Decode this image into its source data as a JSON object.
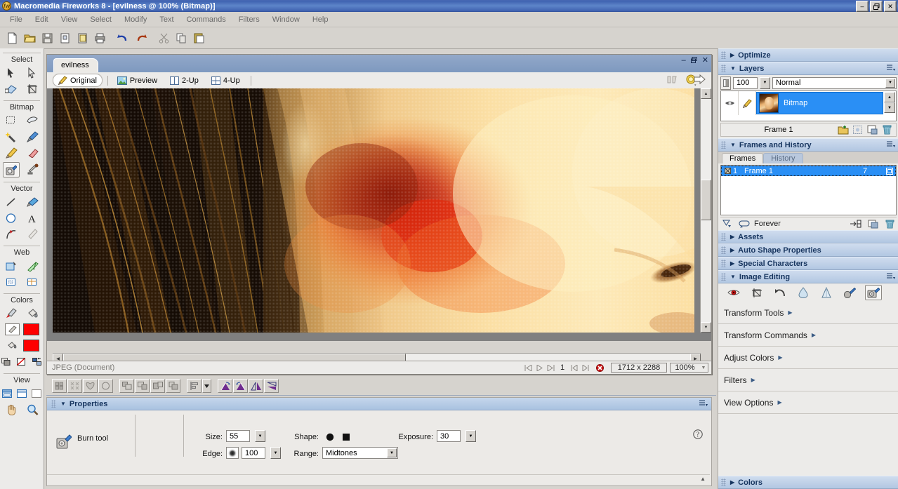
{
  "window": {
    "title": "Macromedia Fireworks 8 - [evilness @ 100% (Bitmap)]",
    "logo_text": "fw",
    "minimize": "–",
    "restore": "❐",
    "close": "✕"
  },
  "menubar": {
    "items": [
      "File",
      "Edit",
      "View",
      "Select",
      "Modify",
      "Text",
      "Commands",
      "Filters",
      "Window",
      "Help"
    ]
  },
  "main_toolbar": {
    "buttons": [
      {
        "name": "new-document-icon",
        "tip": "New"
      },
      {
        "name": "open-folder-icon",
        "tip": "Open"
      },
      {
        "name": "save-icon",
        "tip": "Save"
      },
      {
        "name": "import-icon",
        "tip": "Import"
      },
      {
        "name": "export-icon",
        "tip": "Export"
      },
      {
        "name": "print-icon",
        "tip": "Print"
      },
      {
        "name": "undo-icon",
        "tip": "Undo"
      },
      {
        "name": "redo-icon",
        "tip": "Redo"
      },
      {
        "name": "cut-icon",
        "tip": "Cut"
      },
      {
        "name": "copy-icon",
        "tip": "Copy"
      },
      {
        "name": "paste-icon",
        "tip": "Paste"
      }
    ]
  },
  "tools": {
    "groups": [
      {
        "title": "Select",
        "rows": [
          [
            "pointer-tool-icon",
            "subselection-tool-icon"
          ],
          [
            "scale-tool-icon",
            "crop-tool-icon"
          ]
        ]
      },
      {
        "title": "Bitmap",
        "rows": [
          [
            "marquee-tool-icon",
            "lasso-tool-icon"
          ],
          [
            "magic-wand-tool-icon",
            "brush-tool-icon"
          ],
          [
            "pencil-tool-icon",
            "eraser-tool-icon"
          ],
          [
            "blur-burn-tool-icon",
            "rubber-stamp-tool-icon"
          ]
        ]
      },
      {
        "title": "Vector",
        "rows": [
          [
            "line-tool-icon",
            "vector-path-tool-icon"
          ],
          [
            "ellipse-tool-icon",
            "text-tool-icon"
          ],
          [
            "pen-tool-icon",
            "freeform-tool-icon"
          ]
        ]
      },
      {
        "title": "Web",
        "rows": [
          [
            "hotspot-tool-icon",
            "slice-tool-icon"
          ],
          [
            "hide-slices-icon",
            "show-slices-icon"
          ]
        ]
      },
      {
        "title": "Colors",
        "rows": [
          [
            "eyedropper-tool-icon",
            "paint-bucket-tool-icon"
          ]
        ]
      },
      {
        "title": "View",
        "rows": [
          [
            "full-screen-off-icon",
            "full-screen-menus-icon",
            "full-screen-icon"
          ],
          [
            "hand-tool-icon",
            "zoom-tool-icon"
          ]
        ]
      }
    ],
    "stroke_color": "#fe0000",
    "fill_color": "#fe0000",
    "color_row_icons": [
      "default-colors-icon",
      "no-stroke-or-fill-icon",
      "swap-colors-icon"
    ]
  },
  "document": {
    "tab_label": "evilness",
    "view_tabs": [
      {
        "label": "Original",
        "icon": "pencil-icon",
        "active": true
      },
      {
        "label": "Preview",
        "icon": "image-icon",
        "active": false
      },
      {
        "label": "2-Up",
        "icon": "two-up-icon",
        "active": false
      },
      {
        "label": "4-Up",
        "icon": "four-up-icon",
        "active": false
      }
    ],
    "win_minimize": "–",
    "win_restore": "❐",
    "win_close": "✕",
    "toolbar_right_icons": [
      "hide-slices-icon",
      "quick-export-icon"
    ],
    "status": {
      "file_type": "JPEG (Document)",
      "frame_number": "1",
      "dimensions": "1712 x 2288",
      "zoom": "100%",
      "nav_icons": [
        "first-frame-icon",
        "play-icon",
        "last-frame-icon",
        "prev-frame-icon",
        "next-frame-icon",
        "stop-icon"
      ]
    }
  },
  "align_toolbar": {
    "buttons": [
      "align-left-icon",
      "align-center-horizontal-icon",
      "align-top-icon",
      "align-middle-icon",
      "distribute-widths-icon",
      "distribute-heights-icon",
      "match-width-icon",
      "match-height-icon",
      "align-panel-icon",
      "align-dropdown-icon",
      "rotate-90-cw-icon",
      "rotate-90-ccw-icon",
      "flip-horizontal-icon",
      "flip-vertical-icon"
    ]
  },
  "properties": {
    "title": "Properties",
    "tool_name": "Burn tool",
    "tool_icon": "burn-tool-icon",
    "size_label": "Size:",
    "size_value": "55",
    "edge_label": "Edge:",
    "edge_value": "100",
    "shape_label": "Shape:",
    "shape_options": [
      "circle-shape-icon",
      "square-shape-icon"
    ],
    "range_label": "Range:",
    "range_value": "Midtones",
    "exposure_label": "Exposure:",
    "exposure_value": "30",
    "help_icon": "help-icon"
  },
  "dock": {
    "optimize": {
      "title": "Optimize",
      "expanded": false
    },
    "layers": {
      "title": "Layers",
      "expanded": true,
      "opacity": "100",
      "blend_mode": "Normal",
      "layer_name": "Bitmap",
      "layer_icons": [
        "eye-visibility-icon",
        "lock-edit-icon"
      ],
      "frame_label": "Frame 1",
      "footer_icons": [
        "new-sub-layer-icon",
        "new-bitmap-image-icon",
        "new-layer-icon",
        "delete-layer-icon"
      ]
    },
    "frames_history": {
      "title": "Frames and History",
      "expanded": true,
      "tabs": [
        {
          "label": "Frames",
          "active": true
        },
        {
          "label": "History",
          "active": false
        }
      ],
      "rows": [
        {
          "number": "1",
          "name": "Frame 1",
          "delay": "7"
        }
      ],
      "loop_label": "Forever",
      "footer_icons": [
        "onion-skin-icon",
        "loop-icon",
        "distribute-to-frames-icon",
        "new-frame-icon",
        "delete-frame-icon"
      ]
    },
    "collapsed_panels": [
      {
        "title": "Assets"
      },
      {
        "title": "Auto Shape Properties"
      },
      {
        "title": "Special Characters"
      }
    ],
    "image_editing": {
      "title": "Image Editing",
      "expanded": true,
      "icons": [
        "red-eye-removal-icon",
        "crop-tool-icon",
        "rotate-icon",
        "blur-tool-icon",
        "sharpen-tool-icon",
        "dodge-tool-icon",
        "burn-tool-icon"
      ],
      "selected_index": 6
    },
    "menu_rows": [
      {
        "label": "Transform Tools"
      },
      {
        "label": "Transform Commands"
      },
      {
        "label": "Adjust Colors"
      },
      {
        "label": "Filters"
      },
      {
        "label": "View Options"
      }
    ],
    "colors_panel": {
      "title": "Colors",
      "expanded": false
    }
  }
}
